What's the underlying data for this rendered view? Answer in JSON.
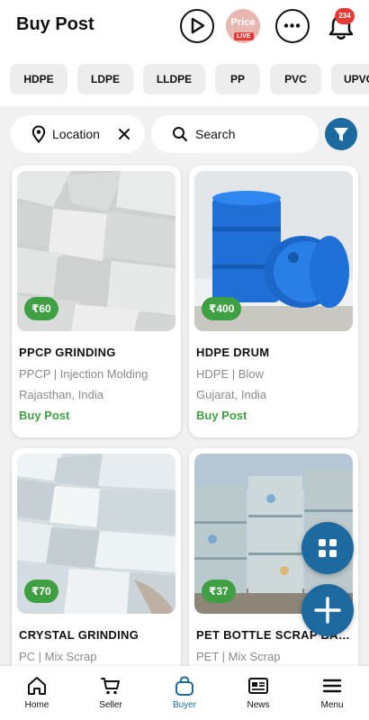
{
  "header": {
    "title": "Buy Post",
    "price_label": "Price",
    "live_label": "LIVE",
    "notification_count": "234"
  },
  "categories": [
    "HDPE",
    "LDPE",
    "LLDPE",
    "PP",
    "PVC",
    "UPVC"
  ],
  "filters": {
    "location_label": "Location",
    "search_label": "Search"
  },
  "posts": [
    {
      "price": "₹60",
      "title": "PPCP GRINDING",
      "subtitle": "PPCP | Injection Molding",
      "location": "Rajasthan, India",
      "action": "Buy Post"
    },
    {
      "price": "₹400",
      "title": "HDPE DRUM",
      "subtitle": "HDPE | Blow",
      "location": "Gujarat, India",
      "action": "Buy Post"
    },
    {
      "price": "₹70",
      "title": "CRYSTAL GRINDING",
      "subtitle": "PC | Mix Scrap",
      "location": "",
      "action": ""
    },
    {
      "price": "₹37",
      "title": "PET BOTTLE SCRAP BAL...",
      "subtitle": "PET | Mix Scrap",
      "location": "",
      "action": ""
    }
  ],
  "nav": [
    {
      "label": "Home",
      "icon": "home-icon"
    },
    {
      "label": "Seller",
      "icon": "cart-icon"
    },
    {
      "label": "Buyer",
      "icon": "bag-icon",
      "active": true
    },
    {
      "label": "News",
      "icon": "newspaper-icon"
    },
    {
      "label": "Menu",
      "icon": "hamburger-menu-icon"
    }
  ],
  "colors": {
    "accent": "#1c6a9f",
    "price_green": "#3ea043",
    "badge_red": "#e53935"
  }
}
